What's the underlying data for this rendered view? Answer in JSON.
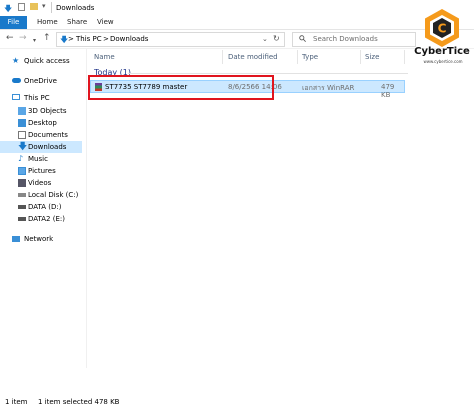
{
  "title_bar": {
    "title": "Downloads"
  },
  "ribbon": {
    "tabs": [
      "File",
      "Home",
      "Share",
      "View"
    ]
  },
  "address": {
    "crumbs": [
      "This PC",
      "Downloads"
    ],
    "separators": [
      ">",
      ">"
    ]
  },
  "search": {
    "placeholder": "Search Downloads"
  },
  "sidebar": {
    "items": [
      {
        "label": "Quick access",
        "icon": "star-icon"
      },
      {
        "label": "OneDrive",
        "icon": "cloud-icon"
      },
      {
        "label": "This PC",
        "icon": "computer-icon"
      },
      {
        "label": "3D Objects",
        "icon": "cube-icon"
      },
      {
        "label": "Desktop",
        "icon": "desktop-icon"
      },
      {
        "label": "Documents",
        "icon": "documents-icon"
      },
      {
        "label": "Downloads",
        "icon": "download-icon"
      },
      {
        "label": "Music",
        "icon": "music-icon"
      },
      {
        "label": "Pictures",
        "icon": "pictures-icon"
      },
      {
        "label": "Videos",
        "icon": "videos-icon"
      },
      {
        "label": "Local Disk (C:)",
        "icon": "drive-icon"
      },
      {
        "label": "DATA (D:)",
        "icon": "drive-icon"
      },
      {
        "label": "DATA2 (E:)",
        "icon": "drive-icon"
      },
      {
        "label": "Network",
        "icon": "network-icon"
      }
    ]
  },
  "columns": {
    "name": "Name",
    "date": "Date modified",
    "type": "Type",
    "size": "Size"
  },
  "group": {
    "label": "Today (1)"
  },
  "file": {
    "name": "ST7735 ST7789 master",
    "date": "8/6/2566 14:06",
    "type": "เอกสาร WinRAR",
    "size": "479 KB"
  },
  "status": {
    "count": "1 item",
    "selected": "1 item selected  478 KB"
  },
  "logo": {
    "brand": "CyberTice",
    "url": "www.cybertice.com"
  },
  "colors": {
    "accent": "#1979ca",
    "highlight": "#e0141e",
    "selection": "#cce8ff",
    "logo_orange": "#f59a1b"
  }
}
